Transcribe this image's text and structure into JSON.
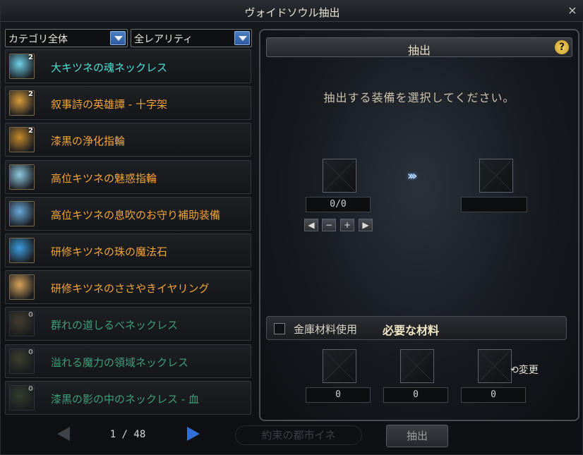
{
  "window": {
    "title": "ヴォイドソウル抽出",
    "close_label": "×"
  },
  "filters": {
    "category": "カテゴリ全体",
    "rarity": "全レアリティ"
  },
  "items": [
    {
      "name": "大キツネの魂ネックレス",
      "badge": "2",
      "color": "#4fe0d6",
      "icon_color": "#6fd1e8",
      "dim": false
    },
    {
      "name": "叙事詩の英雄譚 - 十字架",
      "badge": "2",
      "color": "#f2a43a",
      "icon_color": "#d99b3a",
      "dim": false
    },
    {
      "name": "漆黒の浄化指輪",
      "badge": "2",
      "color": "#f2a43a",
      "icon_color": "#c58a2c",
      "dim": false
    },
    {
      "name": "高位キツネの魅惑指輪",
      "badge": "",
      "color": "#f2a43a",
      "icon_color": "#8fc9e0",
      "dim": false
    },
    {
      "name": "高位キツネの息吹のお守り補助装備",
      "badge": "",
      "color": "#f2a43a",
      "icon_color": "#6aa9d8",
      "dim": false
    },
    {
      "name": "研修キツネの珠の魔法石",
      "badge": "",
      "color": "#f2a43a",
      "icon_color": "#3b9de0",
      "dim": false
    },
    {
      "name": "研修キツネのささやきイヤリング",
      "badge": "",
      "color": "#f2a43a",
      "icon_color": "#d8a35a",
      "dim": false
    },
    {
      "name": "群れの道しるべネックレス",
      "badge": "0",
      "color": "#3f9e77",
      "icon_color": "#6a5a3a",
      "dim": true
    },
    {
      "name": "溢れる魔力の領域ネックレス",
      "badge": "0",
      "color": "#3f9e77",
      "icon_color": "#5a5a3a",
      "dim": true
    },
    {
      "name": "漆黒の影の中のネックレス - 血",
      "badge": "0",
      "color": "#3f9e77",
      "icon_color": "#4a5a3a",
      "dim": true
    }
  ],
  "pager": {
    "text": "1 / 48"
  },
  "extract_panel": {
    "header": "抽出",
    "help": "?",
    "instruction": "抽出する装備を選択してください。",
    "arrows": "›››",
    "source_count": "0/0",
    "stepper": {
      "first": "◀",
      "minus": "−",
      "plus": "+",
      "last": "▶"
    },
    "use_storage_label": "金庫材料使用",
    "required_label": "必要な材料",
    "materials": [
      "0",
      "0",
      "0"
    ],
    "change_label": "⟲変更"
  },
  "extract_button": "抽出",
  "background_text": "約束の都市イネ"
}
